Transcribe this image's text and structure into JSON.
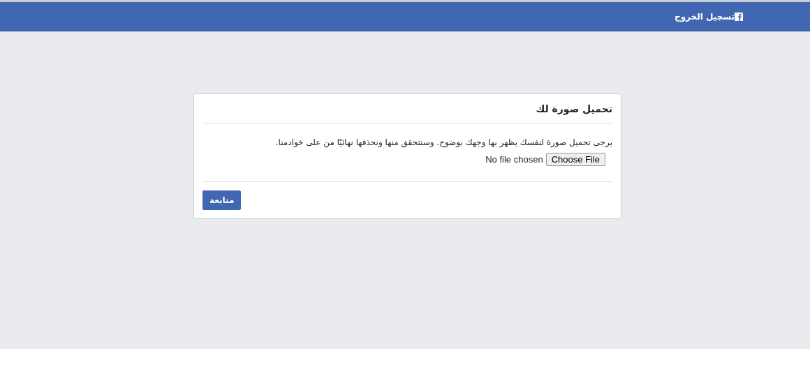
{
  "header": {
    "logout_link": "تسجيل الخروج"
  },
  "dialog": {
    "title": "تحميل صورة لك",
    "message": "يرجى تحميل صورة لنفسك يظهر بها وجهك بوضوح. وسنتحقق منها ونحذفها نهائيًا من على خوادمنا.",
    "file_input": {
      "button": "Choose File",
      "status": "No file chosen"
    },
    "continue_button": "متابعة"
  }
}
